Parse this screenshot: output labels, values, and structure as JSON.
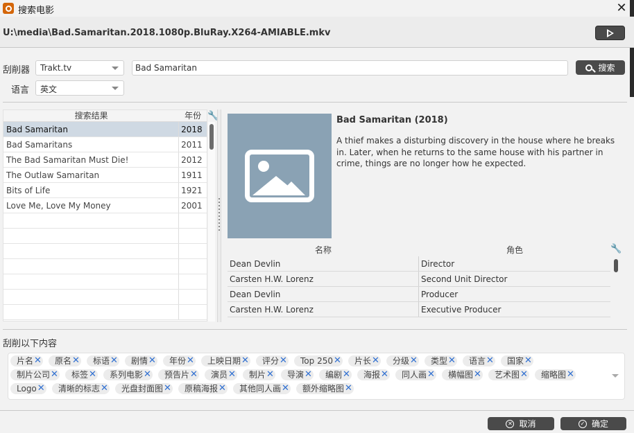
{
  "window": {
    "title": "搜索电影",
    "close_glyph": "✕"
  },
  "file_path": "U:\\media\\Bad.Samaritan.2018.1080p.BluRay.X264-AMIABLE.mkv",
  "scraper": {
    "label": "刮削器",
    "value": "Trakt.tv"
  },
  "language": {
    "label": "语言",
    "value": "英文"
  },
  "search": {
    "value": "Bad Samaritan",
    "button_label": "搜索"
  },
  "results": {
    "columns": [
      "搜索结果",
      "年份"
    ],
    "rows": [
      {
        "title": "Bad Samaritan",
        "year": "2018"
      },
      {
        "title": "Bad Samaritans",
        "year": "2011"
      },
      {
        "title": "The Bad Samaritan Must Die!",
        "year": "2012"
      },
      {
        "title": "The Outlaw Samaritan",
        "year": "1911"
      },
      {
        "title": "Bits of Life",
        "year": "1921"
      },
      {
        "title": "Love Me, Love My Money",
        "year": "2001"
      }
    ]
  },
  "detail": {
    "title": "Bad Samaritan (2018)",
    "description": "A thief makes a disturbing discovery in the house where he breaks in. Later, when he returns to the same house with his partner in crime, things are no longer how he expected.",
    "cast_columns": [
      "名称",
      "角色"
    ],
    "cast": [
      {
        "name": "Dean Devlin",
        "role": "Director"
      },
      {
        "name": "Carsten H.W. Lorenz",
        "role": "Second Unit Director"
      },
      {
        "name": "Dean Devlin",
        "role": "Producer"
      },
      {
        "name": "Carsten H.W. Lorenz",
        "role": "Executive Producer"
      }
    ]
  },
  "scrape_section": {
    "label": "刮削以下内容",
    "tags": [
      "片名",
      "原名",
      "标语",
      "剧情",
      "年份",
      "上映日期",
      "评分",
      "Top 250",
      "片长",
      "分级",
      "类型",
      "语言",
      "国家",
      "制片公司",
      "标签",
      "系列电影",
      "预告片",
      "演员",
      "制片",
      "导演",
      "编剧",
      "海报",
      "同人画",
      "横幅图",
      "艺术图",
      "缩略图",
      "Logo",
      "清晰的标志",
      "光盘封面图",
      "原稿海报",
      "其他同人画",
      "额外缩略图"
    ]
  },
  "buttons": {
    "cancel": "取消",
    "ok": "确定"
  },
  "colors": {
    "dark_button": "#4a4a4a",
    "selected_row": "#cfd9e3",
    "poster_bg": "#8aa2b4",
    "tag_remove": "#2f6fd1",
    "app_icon": "#d4660a"
  }
}
